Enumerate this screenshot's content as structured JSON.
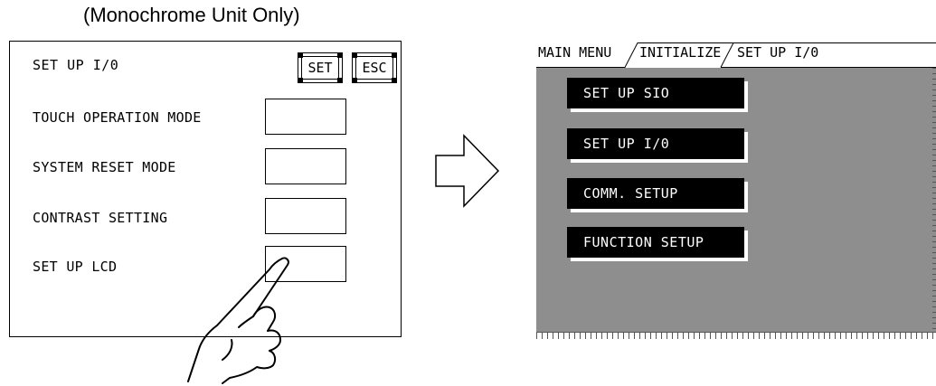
{
  "caption": "(Monochrome Unit Only)",
  "left_screen": {
    "title": "SET UP I/0",
    "set_button": "SET",
    "esc_button": "ESC",
    "rows": [
      {
        "label": "TOUCH OPERATION MODE"
      },
      {
        "label": "SYSTEM RESET MODE"
      },
      {
        "label": "CONTRAST SETTING"
      },
      {
        "label": "SET UP LCD"
      }
    ]
  },
  "right_screen": {
    "tabs": [
      "MAIN MENU",
      "INITIALIZE",
      "SET UP I/0"
    ],
    "menu": [
      "SET UP SIO",
      "SET UP I/0",
      "COMM. SETUP",
      "FUNCTION SETUP"
    ]
  },
  "colors": {
    "screen_background": "#8e8e8e",
    "menu_button": "#000000",
    "menu_text": "#ffffff"
  },
  "icons": {
    "arrow": "right-arrow-icon",
    "hand": "pointing-hand-icon"
  }
}
